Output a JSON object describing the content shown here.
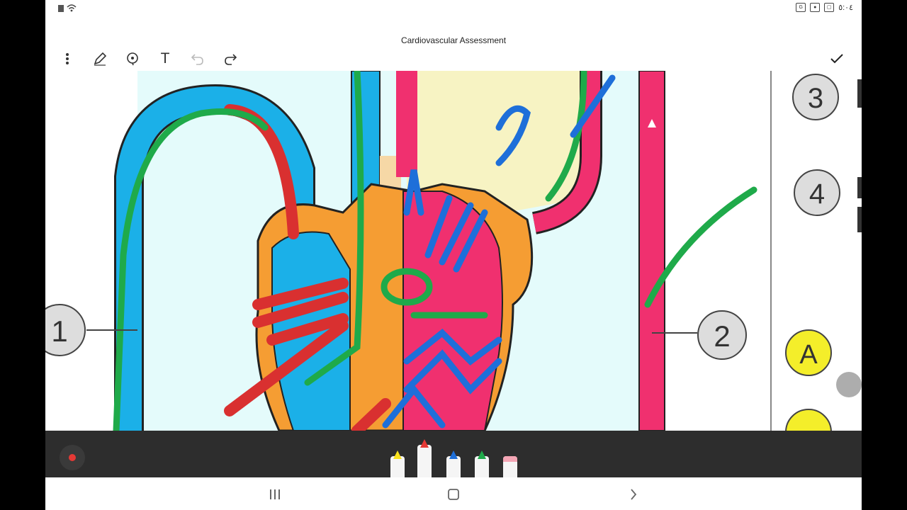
{
  "statusbar": {
    "time": "٥:٠٤"
  },
  "document": {
    "title": "Cardiovascular Assessment"
  },
  "diagram": {
    "labels": [
      {
        "text": "1"
      },
      {
        "text": "2"
      },
      {
        "text": "3"
      },
      {
        "text": "4"
      },
      {
        "text": "A"
      }
    ]
  },
  "toolbar": {
    "text_tool_glyph": "T"
  },
  "pens": [
    {
      "color": "#f9e11c"
    },
    {
      "color": "#e53935"
    },
    {
      "color": "#1e6fd9"
    },
    {
      "color": "#1faa4a"
    },
    {
      "color": "#f4a6b5"
    }
  ],
  "icons": {
    "more": "more-vert-icon",
    "pen": "pen-icon",
    "lasso": "lasso-icon",
    "text": "text-icon",
    "undo": "undo-icon",
    "redo": "redo-icon",
    "done": "check-icon",
    "record": "record-icon",
    "nav_recents": "recents-icon",
    "nav_home": "home-icon",
    "nav_back": "back-icon"
  }
}
